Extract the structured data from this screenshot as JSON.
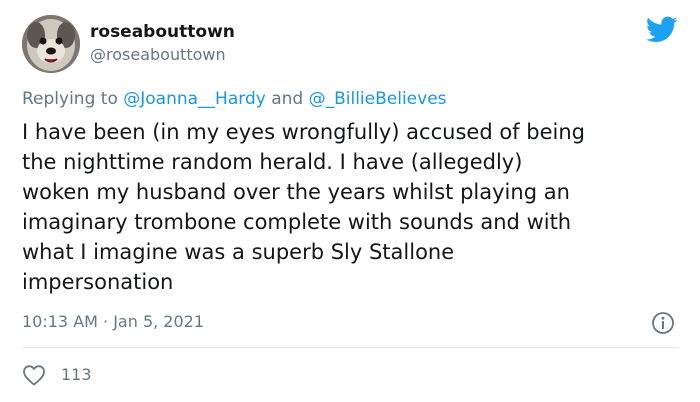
{
  "user": {
    "display_name": "roseabouttown",
    "handle": "@roseabouttown"
  },
  "reply": {
    "prefix": "Replying to",
    "mention_1": "@Joanna__Hardy",
    "conjunction": "and",
    "mention_2": "@_BillieBelieves"
  },
  "tweet": {
    "lines": [
      "I have been (in my eyes wrongfully) accused of being",
      "the nighttime random herald. I have (allegedly)",
      "woken my husband over the years whilst playing an",
      "imaginary trombone complete with sounds and with",
      "what I imagine was a superb Sly Stallone",
      "impersonation"
    ]
  },
  "meta": {
    "timestamp": "10:13 AM · Jan 5, 2021"
  },
  "actions": {
    "like_count": "113"
  },
  "icons": {
    "logo": "twitter-bird-icon",
    "info": "info-icon",
    "like": "heart-icon"
  },
  "colors": {
    "brand": "#1da1f2",
    "mention": "#1b95e0",
    "secondary_text": "#657786",
    "primary_text": "#14171a",
    "divider": "#e1e8ed"
  }
}
